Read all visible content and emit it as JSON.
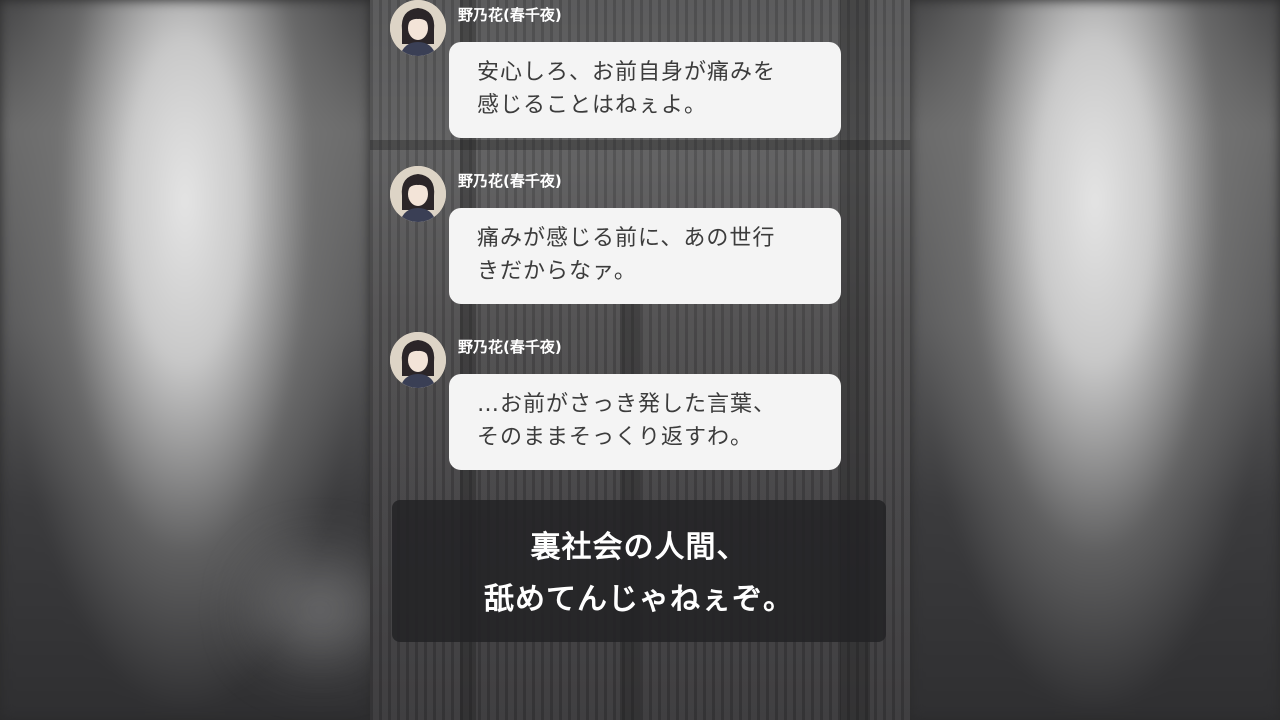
{
  "messages": [
    {
      "sender": "野乃花(春千夜)",
      "lines": [
        "安心しろ、お前自身が痛みを",
        "感じることはねぇよ。"
      ]
    },
    {
      "sender": "野乃花(春千夜)",
      "lines": [
        "痛みが感じる前に、あの世行",
        "きだからなァ。"
      ]
    },
    {
      "sender": "野乃花(春千夜)",
      "lines": [
        "…お前がさっき発した言葉、",
        "そのままそっくり返すわ。"
      ]
    }
  ],
  "caption": {
    "lines": [
      "裏社会の人間、",
      "舐めてんじゃねぇぞ。"
    ]
  },
  "icons": {
    "avatar": "character-avatar-icon"
  },
  "colors": {
    "bubble_bg": "#f4f4f4",
    "bubble_text": "#3c3c3c",
    "caption_bg": "#232326",
    "name_text": "#ffffff"
  }
}
